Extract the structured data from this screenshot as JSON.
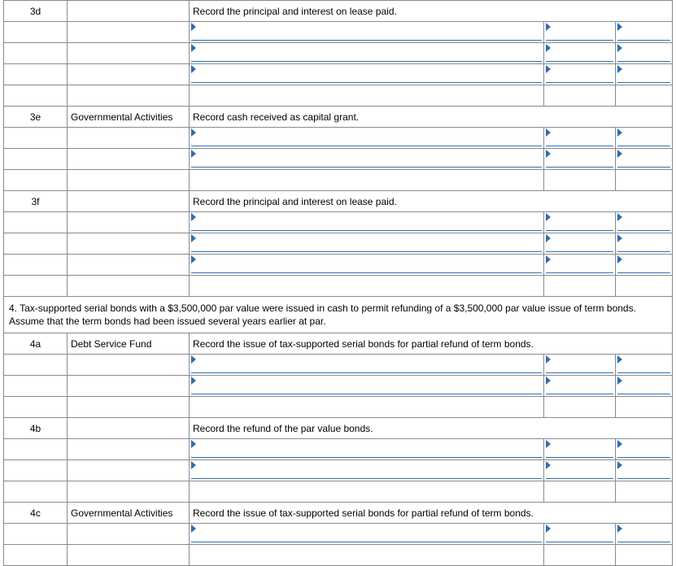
{
  "sections": [
    {
      "id": "3d",
      "fund": "",
      "instruction": "Record the principal and interest on lease paid.",
      "entry_rows": 3,
      "blank_rows": 1
    },
    {
      "id": "3e",
      "fund": "Governmental Activities",
      "instruction": "Record cash received as capital grant.",
      "entry_rows": 2,
      "blank_rows": 1
    },
    {
      "id": "3f",
      "fund": "",
      "instruction": "Record the principal and interest on lease paid.",
      "entry_rows": 3,
      "blank_rows": 1
    }
  ],
  "narrative": "4. Tax-supported serial bonds with a $3,500,000 par value were issued in cash to permit refunding of a $3,500,000 par value issue of term bonds. Assume that the term bonds had been issued several years earlier at par.",
  "sections2": [
    {
      "id": "4a",
      "fund": "Debt Service Fund",
      "instruction": "Record the issue of tax-supported serial bonds for partial refund of term bonds.",
      "entry_rows": 2,
      "blank_rows": 1
    },
    {
      "id": "4b",
      "fund": "",
      "instruction": "Record the refund of the par value bonds.",
      "entry_rows": 2,
      "blank_rows": 1
    },
    {
      "id": "4c",
      "fund": "Governmental Activities",
      "instruction": "Record the issue of tax-supported serial bonds for partial refund of term bonds.",
      "entry_rows": 1,
      "blank_rows": 1
    }
  ]
}
